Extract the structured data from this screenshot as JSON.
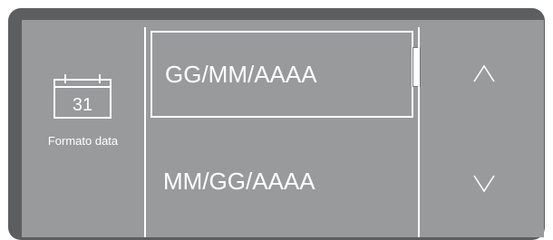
{
  "setting": {
    "icon": "calendar-icon",
    "day_number": "31",
    "label": "Formato data"
  },
  "options": [
    {
      "label": "GG/MM/AAAA",
      "selected": true
    },
    {
      "label": "MM/GG/AAAA",
      "selected": false
    }
  ],
  "navigation": {
    "up_icon": "chevron-up-icon",
    "down_icon": "chevron-down-icon"
  },
  "colors": {
    "screen": "#989a9c",
    "bezel": "#5d5e60",
    "foreground": "#ffffff"
  }
}
